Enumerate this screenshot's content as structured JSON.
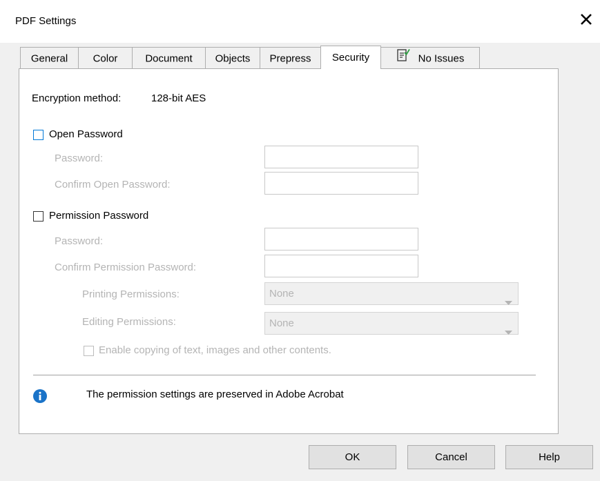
{
  "window": {
    "title": "PDF Settings"
  },
  "tabs": [
    {
      "label": "General"
    },
    {
      "label": "Color"
    },
    {
      "label": "Document"
    },
    {
      "label": "Objects"
    },
    {
      "label": "Prepress"
    },
    {
      "label": "Security"
    },
    {
      "label": "No Issues",
      "icon": "preflight-check-icon"
    }
  ],
  "active_tab": "Security",
  "encryption": {
    "label": "Encryption method:",
    "value": "128-bit AES"
  },
  "open_password": {
    "checkbox_label": "Open Password",
    "checked": false,
    "password_label": "Password:",
    "confirm_label": "Confirm Open Password:",
    "password_value": "",
    "confirm_value": ""
  },
  "permission_password": {
    "checkbox_label": "Permission Password",
    "checked": false,
    "password_label": "Password:",
    "confirm_label": "Confirm Permission Password:",
    "printing_label": "Printing Permissions:",
    "printing_value": "None",
    "editing_label": "Editing Permissions:",
    "editing_value": "None",
    "copy_label": "Enable copying of text, images and other contents.",
    "copy_checked": false
  },
  "info": {
    "icon": "info-icon",
    "text": "The permission settings are preserved in Adobe Acrobat"
  },
  "buttons": {
    "ok": "OK",
    "cancel": "Cancel",
    "help": "Help"
  },
  "colors": {
    "accent": "#0078d7",
    "info_blue": "#1a73c8",
    "disabled_text": "#b4b4b4"
  }
}
